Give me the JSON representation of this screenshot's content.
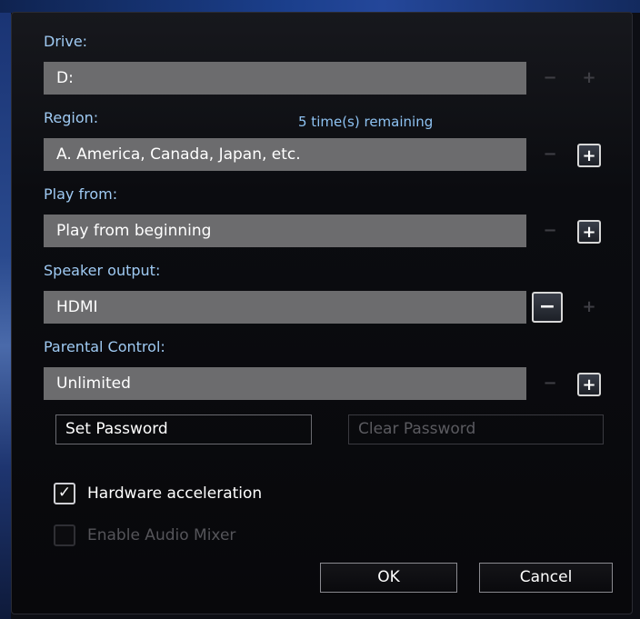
{
  "drive": {
    "label": "Drive:",
    "value": "D:",
    "minus": "−",
    "plus": "+"
  },
  "region": {
    "label": "Region:",
    "remaining": "5 time(s) remaining",
    "value": "A. America, Canada, Japan, etc.",
    "minus": "−",
    "plus": "+"
  },
  "play_from": {
    "label": "Play from:",
    "value": "Play from beginning",
    "minus": "−",
    "plus": "+"
  },
  "speaker_output": {
    "label": "Speaker output:",
    "value": "HDMI",
    "minus": "−",
    "plus": "+"
  },
  "parental_control": {
    "label": "Parental Control:",
    "value": "Unlimited",
    "minus": "−",
    "plus": "+"
  },
  "password": {
    "set_label": "Set Password",
    "clear_label": "Clear Password"
  },
  "options": {
    "hardware_acceleration": {
      "label": "Hardware acceleration",
      "checked": true,
      "mark": "✓"
    },
    "audio_mixer": {
      "label": "Enable Audio Mixer",
      "checked": false,
      "enabled": false
    }
  },
  "buttons": {
    "ok": "OK",
    "cancel": "Cancel"
  },
  "colors": {
    "label_blue": "#9fcaf3",
    "field_gray": "#6c6c6e",
    "dialog_bg": "#0b0c10"
  }
}
